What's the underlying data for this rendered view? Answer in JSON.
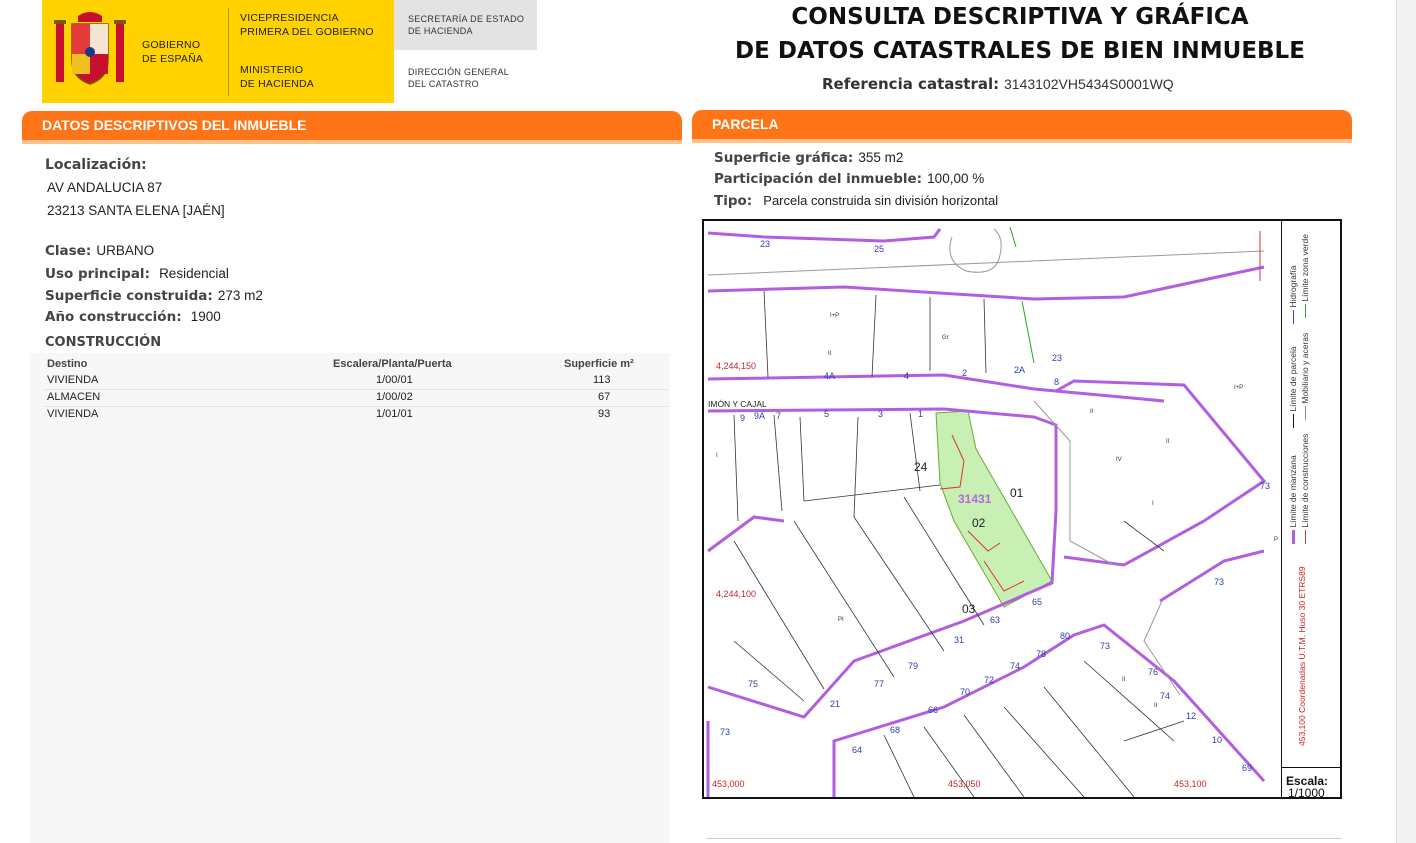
{
  "header": {
    "gov_name": [
      "GOBIERNO",
      "DE ESPAÑA"
    ],
    "vice": [
      "VICEPRESIDENCIA",
      "PRIMERA DEL GOBIERNO"
    ],
    "ministry": [
      "MINISTERIO",
      "DE HACIENDA"
    ],
    "secretaria": [
      "SECRETARÍA DE ESTADO",
      "DE HACIENDA"
    ],
    "direccion": [
      "DIRECCIÓN GENERAL",
      "DEL CATASTRO"
    ],
    "title_line1": "CONSULTA DESCRIPTIVA Y GRÁFICA",
    "title_line2": "DE DATOS CATASTRALES DE BIEN INMUEBLE",
    "ref_label": "Referencia catastral:",
    "ref_value": "3143102VH5434S0001WQ"
  },
  "colors": {
    "accent": "#ff7417",
    "logo_yellow": "#ffd200",
    "parcel_green": "#c8f0b4",
    "boundary_purple": "#b25ee0"
  },
  "datos": {
    "section_title": "DATOS DESCRIPTIVOS DEL INMUEBLE",
    "localizacion_label": "Localización:",
    "address_line1": "AV ANDALUCIA 87",
    "address_line2": "23213 SANTA ELENA [JAÉN]",
    "clase_label": "Clase:",
    "clase_value": "URBANO",
    "uso_label": "Uso principal:",
    "uso_value": "Residencial",
    "superficie_label": "Superficie construida:",
    "superficie_value": "273 m2",
    "anio_label": "Año construcción:",
    "anio_value": "1900"
  },
  "construccion": {
    "title": "CONSTRUCCIÓN",
    "headers": [
      "Destino",
      "Escalera/Planta/Puerta",
      "Superficie m²"
    ],
    "rows": [
      [
        "VIVIENDA",
        "1/00/01",
        "113"
      ],
      [
        "ALMACEN",
        "1/00/02",
        "67"
      ],
      [
        "VIVIENDA",
        "1/01/01",
        "93"
      ]
    ]
  },
  "parcela": {
    "section_title": "PARCELA",
    "superficie_label": "Superficie gráfica:",
    "superficie_value": "355 m2",
    "participacion_label": "Participación del inmueble:",
    "participacion_value": "100,00 %",
    "tipo_label": "Tipo:",
    "tipo_value": "Parcela construida sin división horizontal"
  },
  "map": {
    "parcel_id": "31431",
    "unit_labels": [
      "01",
      "02",
      "03",
      "24"
    ],
    "street_label": "IMÓN Y CAJAL",
    "plot_numbers": [
      "23",
      "25",
      "6",
      "4A",
      "4",
      "2",
      "2A",
      "23",
      "8",
      "9",
      "9A",
      "7",
      "5",
      "3",
      "1",
      "67",
      "65",
      "63",
      "31",
      "79",
      "77",
      "21",
      "75",
      "73",
      "62",
      "64",
      "68",
      "66",
      "70",
      "72",
      "74",
      "78",
      "80",
      "73",
      "76",
      "74",
      "12",
      "10",
      "69",
      "73"
    ],
    "coord_y1": "4,244,150",
    "coord_y2": "4,244,100",
    "coord_x1": "453,000",
    "coord_x2": "453,050",
    "coord_x3": "453,100",
    "floor_codes": [
      "I+P",
      "Gr",
      "II",
      "I",
      "IV",
      "II",
      "I+P",
      "I",
      "PI",
      "II",
      "II",
      "P",
      "II"
    ],
    "legend": [
      "Límite de manzana",
      "Límite de parcela",
      "Hidrografía",
      "Límite de construcciones",
      "Mobiliario y aceras",
      "Límite zona verde"
    ],
    "coords_note": "453,100 Coordenadas U.T.M. Huso 30 ETRS89",
    "scale_label": "Escala:",
    "scale_value": "1/1000"
  }
}
